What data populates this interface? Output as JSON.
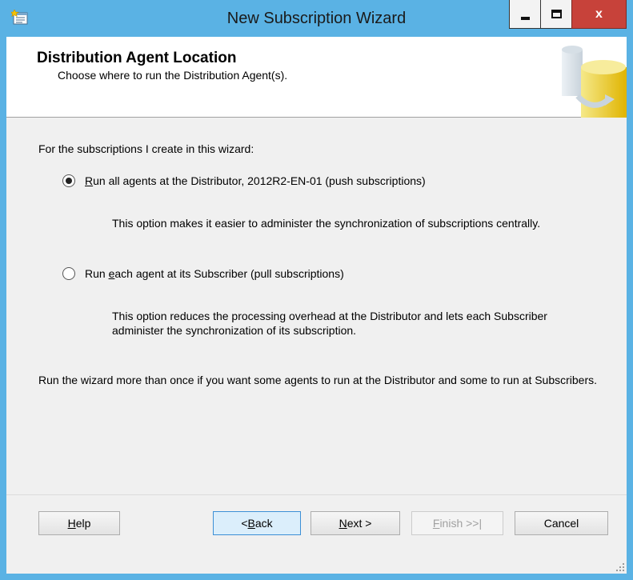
{
  "window": {
    "title": "New Subscription Wizard",
    "accent_color": "#5ab2e4",
    "close_color": "#c7423a",
    "icons": {
      "app": "wizard-app-icon",
      "minimize": "minimize-icon",
      "maximize": "maximize-icon",
      "close": "close-icon"
    },
    "close_glyph": "x"
  },
  "header": {
    "title": "Distribution Agent Location",
    "subtitle": "Choose where to run the Distribution Agent(s).",
    "graphic_icon": "database-replication-icon"
  },
  "content": {
    "intro": "For the subscriptions I create in this wizard:",
    "options": [
      {
        "mnemonic": "R",
        "label_rest": "un all agents at the Distributor, 2012R2-EN-01 (push subscriptions)",
        "selected": true,
        "description": "This option makes it easier to administer the synchronization of subscriptions centrally."
      },
      {
        "label_pre": "Run ",
        "mnemonic": "e",
        "label_rest": "ach agent at its Subscriber (pull subscriptions)",
        "selected": false,
        "description": "This option reduces the processing overhead at the Distributor and lets each Subscriber administer the synchronization of its subscription."
      }
    ],
    "note": "Run the wizard more than once if you want some agents to run at the Distributor and some to run at Subscribers."
  },
  "buttons": {
    "help": {
      "mnemonic": "H",
      "rest": "elp"
    },
    "back": {
      "pre": "< ",
      "mnemonic": "B",
      "rest": "ack"
    },
    "next": {
      "mnemonic": "N",
      "rest": "ext >"
    },
    "finish": {
      "mnemonic": "F",
      "rest": "inish >>|",
      "enabled": false
    },
    "cancel": {
      "label": "Cancel"
    }
  }
}
